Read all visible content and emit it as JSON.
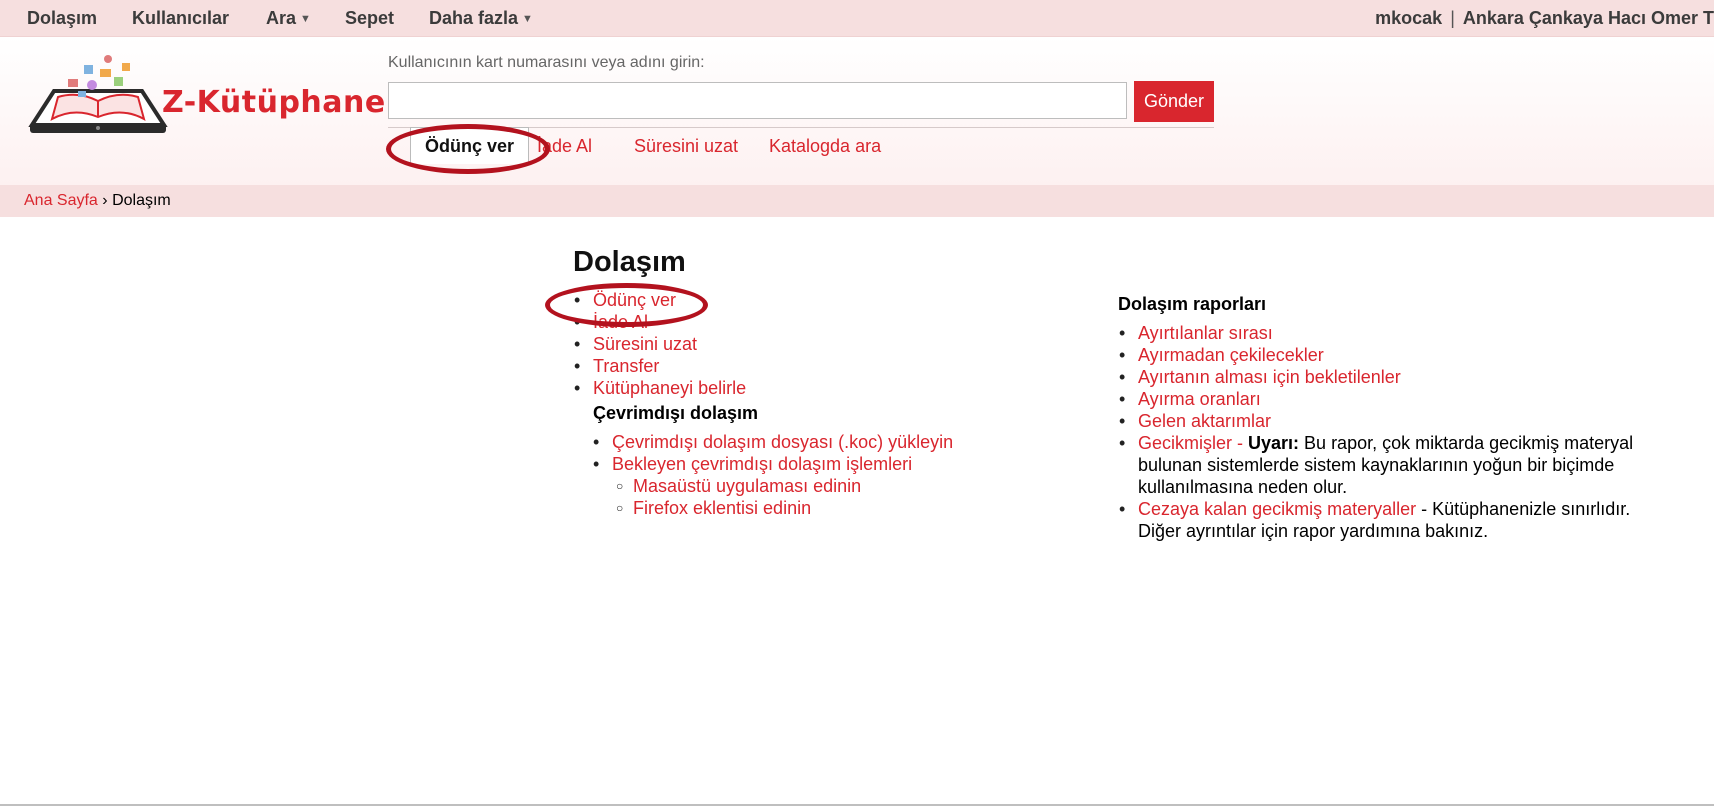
{
  "topnav": {
    "items": [
      {
        "label": "Dolaşım"
      },
      {
        "label": "Kullanıcılar"
      },
      {
        "label": "Ara"
      },
      {
        "label": "Sepet"
      },
      {
        "label": "Daha fazla"
      }
    ],
    "user": "mkocak",
    "separator": "|",
    "library": "Ankara Çankaya Hacı Omer T"
  },
  "header": {
    "logo_text": "Z-Kütüphane",
    "search_label": "Kullanıcının kart numarasını veya adını girin:",
    "search_value": "",
    "submit_label": "Gönder",
    "tabs": [
      {
        "label": "Ödünç ver",
        "active": true
      },
      {
        "label": "İade Al"
      },
      {
        "label": "Süresini uzat"
      },
      {
        "label": "Katalogda ara"
      }
    ]
  },
  "breadcrumb": {
    "home": "Ana Sayfa",
    "separator": "›",
    "current": "Dolaşım"
  },
  "main": {
    "title": "Dolaşım",
    "links": [
      "Ödünç ver",
      "İade Al",
      "Süresini uzat",
      "Transfer",
      "Kütüphaneyi belirle"
    ],
    "offline_title": "Çevrimdışı dolaşım",
    "offline_links": [
      "Çevrimdışı dolaşım dosyası (.koc) yükleyin",
      "Bekleyen çevrimdışı dolaşım işlemleri"
    ],
    "offline_sub_links": [
      "Masaüstü uygulaması edinin",
      "Firefox eklentisi edinin"
    ]
  },
  "reports": {
    "title": "Dolaşım raporları",
    "links": [
      "Ayırtılanlar sırası",
      "Ayırmadan çekilecekler",
      "Ayırtanın alması için bekletilenler",
      "Ayırma oranları",
      "Gelen aktarımlar"
    ],
    "overdue_link": "Gecikmişler",
    "overdue_dash": " - ",
    "overdue_warning_label": "Uyarı:",
    "overdue_warning_text": " Bu rapor, çok miktarda gecikmiş materyal bulunan sistemlerde sistem kaynaklarının yoğun bir biçimde kullanılmasına neden olur.",
    "fines_link": "Cezaya kalan gecikmiş materyaller",
    "fines_text": " - Kütüphanenizle sınırlıdır. Diğer ayrıntılar için rapor yardımına bakınız."
  },
  "colors": {
    "accent": "#d9262e",
    "nav_bg": "#f6dfdf",
    "annotation": "#b3121e"
  }
}
